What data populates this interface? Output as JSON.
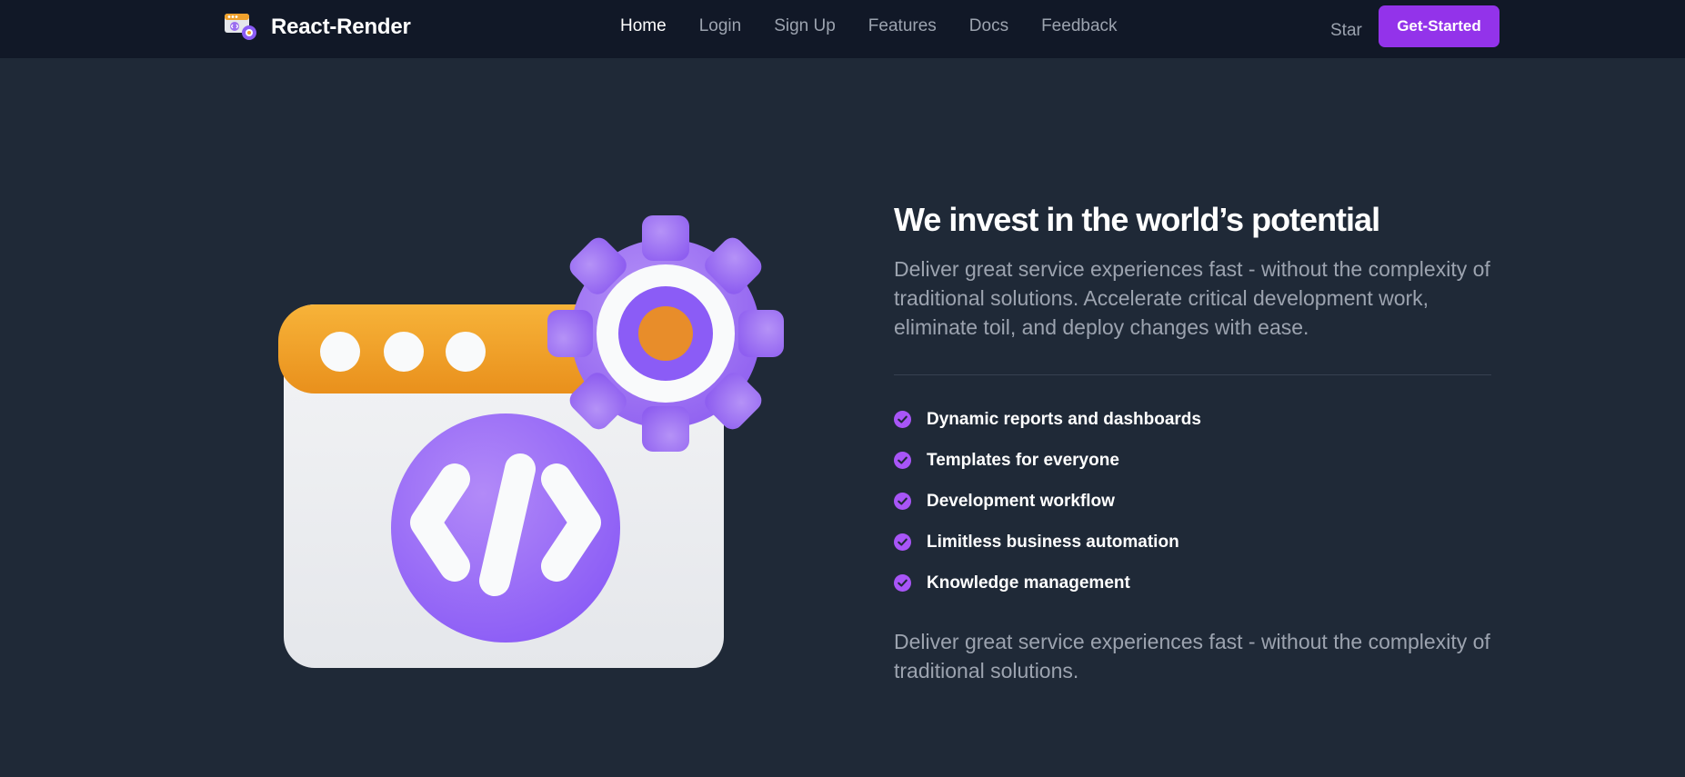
{
  "brand": {
    "name": "React-Render",
    "logo_icon": "code-window-gear-icon"
  },
  "nav": {
    "links": [
      {
        "label": "Home",
        "active": true
      },
      {
        "label": "Login",
        "active": false
      },
      {
        "label": "Sign Up",
        "active": false
      },
      {
        "label": "Features",
        "active": false
      },
      {
        "label": "Docs",
        "active": false
      },
      {
        "label": "Feedback",
        "active": false
      }
    ],
    "star_label": "Star",
    "cta_label": "Get-Started"
  },
  "hero": {
    "illustration_icon": "code-window-gear-icon",
    "headline": "We invest in the world’s potential",
    "lead": "Deliver great service experiences fast - without the complexity of traditional solutions. Accelerate critical development work, eliminate toil, and deploy changes with ease.",
    "features": [
      "Dynamic reports and dashboards",
      "Templates for everyone",
      "Development workflow",
      "Limitless business automation",
      "Knowledge management"
    ],
    "closing": "Deliver great service experiences fast - without the complexity of traditional solutions."
  },
  "colors": {
    "page_bg": "#1f2937",
    "nav_bg": "#111827",
    "accent": "#9333ea",
    "check": "#a855f7",
    "muted_text": "#9ca3af",
    "illustration_orange": "#f0a12c",
    "illustration_purple": "#9b6ef0"
  }
}
